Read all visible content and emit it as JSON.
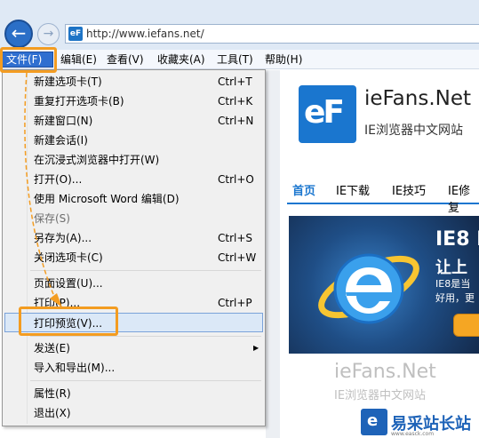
{
  "window": {
    "address_url": "http://www.iefans.net/",
    "site_icon_text": "eF"
  },
  "menubar": {
    "items": [
      "文件(F)",
      "编辑(E)",
      "查看(V)",
      "收藏夹(A)",
      "工具(T)",
      "帮助(H)"
    ]
  },
  "file_menu": {
    "items": [
      {
        "label": "新建选项卡(T)",
        "shortcut": "Ctrl+T"
      },
      {
        "label": "重复打开选项卡(B)",
        "shortcut": "Ctrl+K"
      },
      {
        "label": "新建窗口(N)",
        "shortcut": "Ctrl+N"
      },
      {
        "label": "新建会话(I)",
        "shortcut": ""
      },
      {
        "label": "在沉浸式浏览器中打开(W)",
        "shortcut": ""
      },
      {
        "label": "打开(O)...",
        "shortcut": "Ctrl+O"
      },
      {
        "label": "使用 Microsoft Word 编辑(D)",
        "shortcut": ""
      },
      {
        "label": "保存(S)",
        "shortcut": "",
        "disabled": true
      },
      {
        "label": "另存为(A)...",
        "shortcut": "Ctrl+S"
      },
      {
        "label": "关闭选项卡(C)",
        "shortcut": "Ctrl+W"
      },
      {
        "label": "页面设置(U)...",
        "shortcut": ""
      },
      {
        "label": "打印(P)...",
        "shortcut": "Ctrl+P"
      },
      {
        "label": "打印预览(V)...",
        "shortcut": "",
        "highlighted": true
      },
      {
        "label": "发送(E)",
        "shortcut": "",
        "submenu": true
      },
      {
        "label": "导入和导出(M)...",
        "shortcut": ""
      },
      {
        "label": "属性(R)",
        "shortcut": ""
      },
      {
        "label": "退出(X)",
        "shortcut": ""
      }
    ]
  },
  "page": {
    "logo_title": "ieFans.Net",
    "logo_subtitle": "IE浏览器中文网站",
    "nav": [
      "首页",
      "IE下载",
      "IE技巧",
      "IE修复"
    ],
    "banner": {
      "title": "IE8 I",
      "line2": "让上",
      "line3": "IE8是当",
      "line4": "好用，更"
    },
    "watermark_title": "ieFans.Net",
    "watermark_subtitle": "IE浏览器中文网站",
    "footer_logo_text": "易采站长站",
    "footer_small_text": "www.easck.com"
  },
  "colors": {
    "accent": "#2f6fd0",
    "highlight": "#f39c21",
    "brand": "#1a76cf"
  }
}
